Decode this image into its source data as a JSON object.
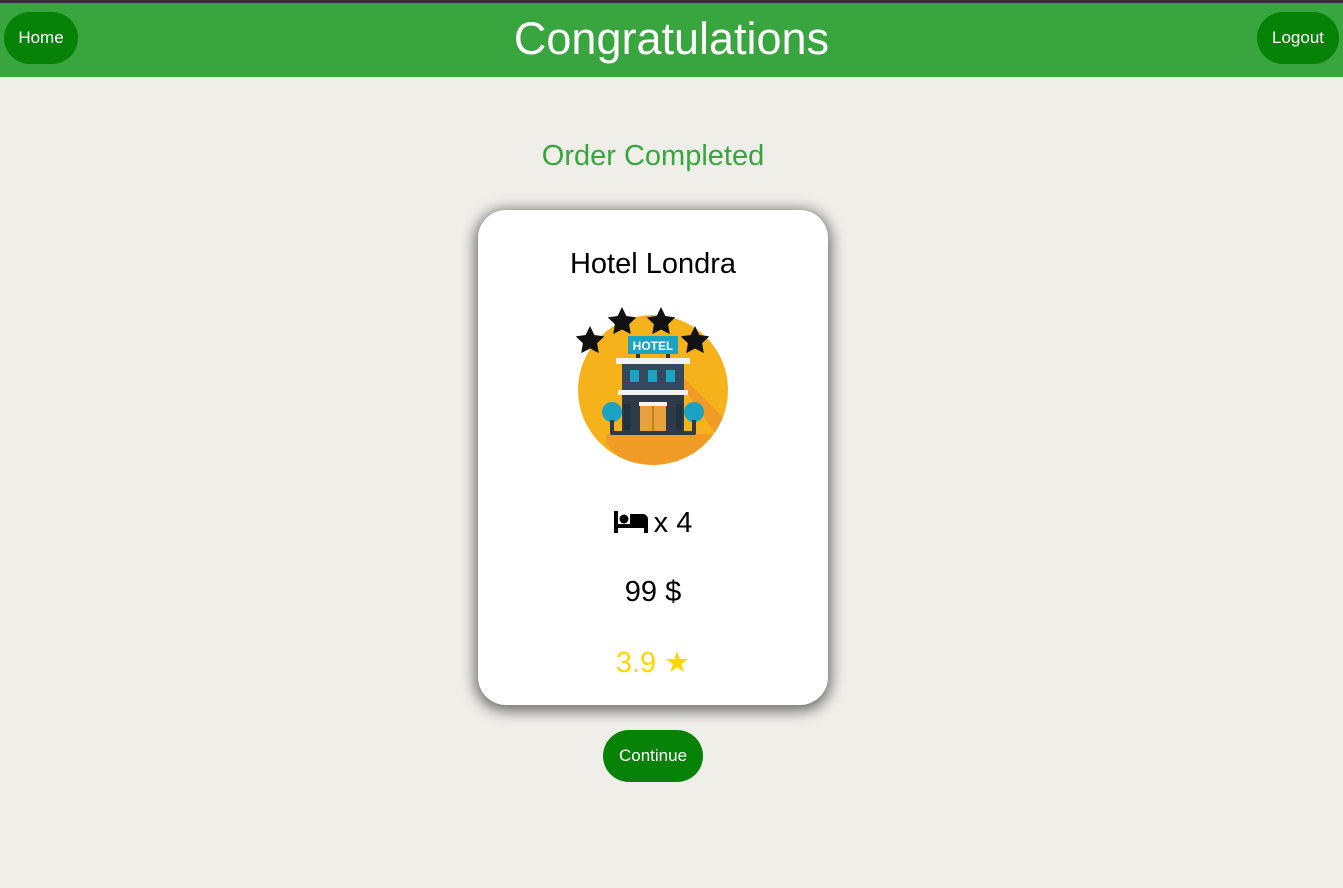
{
  "header": {
    "title": "Congratulations",
    "home_label": "Home",
    "logout_label": "Logout"
  },
  "main": {
    "status": "Order Completed",
    "card": {
      "hotel_name": "Hotel Londra",
      "image_sign_text": "HOTEL",
      "hotel_stars_shown": 4,
      "rooms_text": "x 4",
      "bed_icon": "bed-icon",
      "price_text": "99 $",
      "rating_text": "3.9 ★"
    },
    "continue_label": "Continue"
  },
  "colors": {
    "page_background": "#efeee9",
    "header_background": "#38a53f",
    "button_background": "#068206",
    "status_text": "#38a53f",
    "rating_text": "#ffd700",
    "image_circle": "#f6b21b"
  }
}
